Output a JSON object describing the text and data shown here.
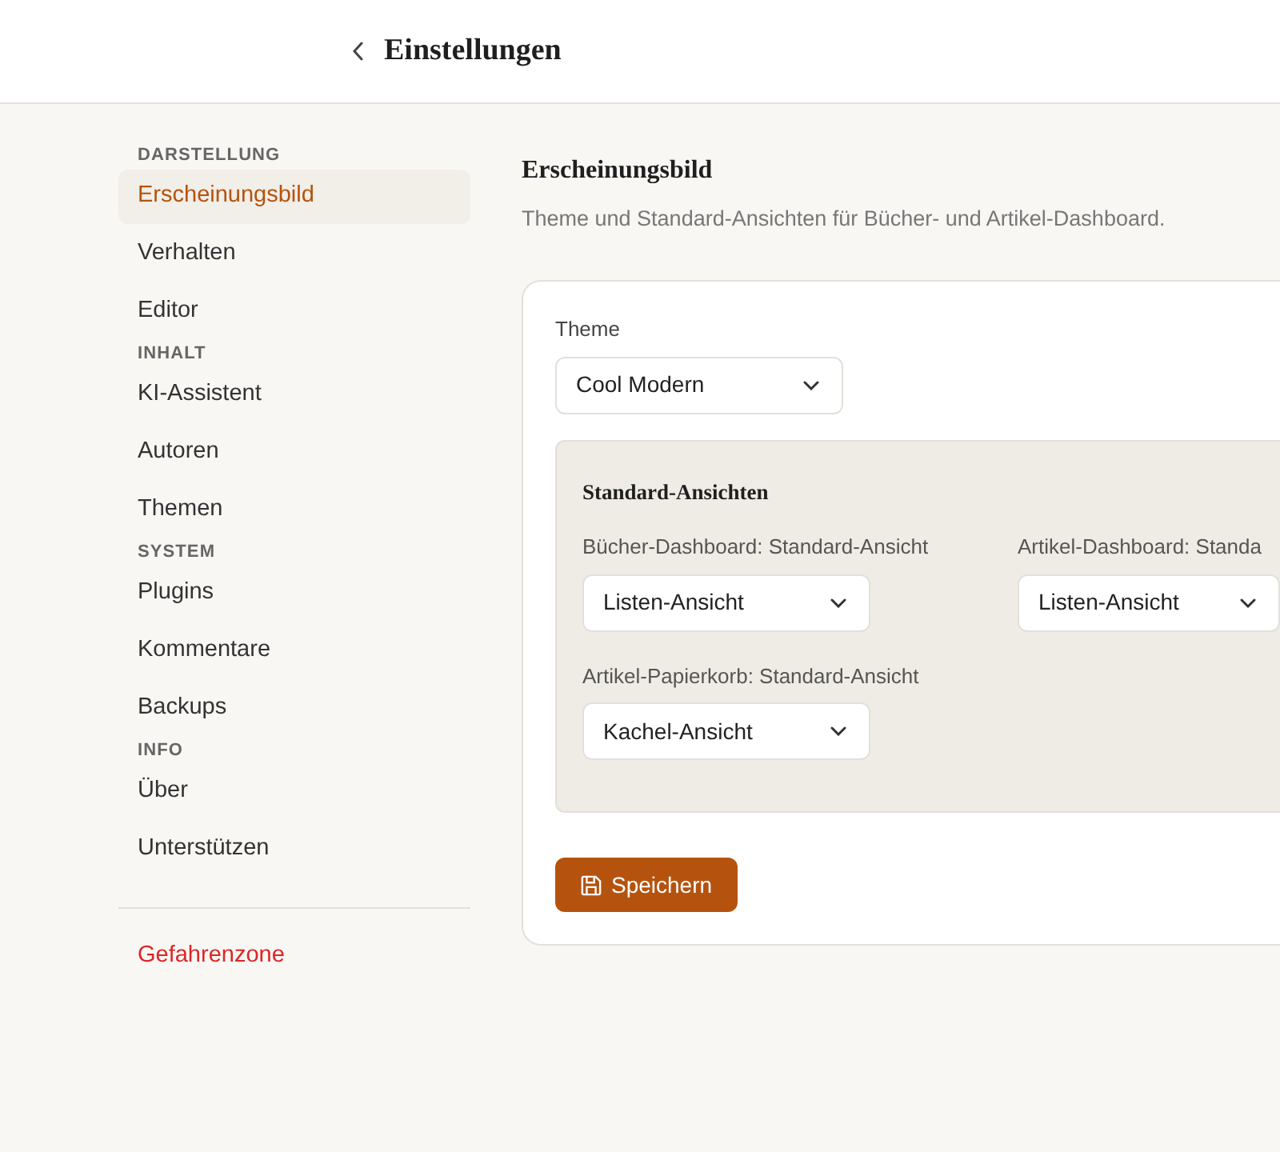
{
  "header": {
    "title": "Einstellungen"
  },
  "sidebar": {
    "sections": [
      {
        "heading": "DARSTELLUNG",
        "items": [
          {
            "label": "Erscheinungsbild",
            "selected": true
          },
          {
            "label": "Verhalten",
            "selected": false
          },
          {
            "label": "Editor",
            "selected": false
          }
        ]
      },
      {
        "heading": "INHALT",
        "items": [
          {
            "label": "KI-Assistent",
            "selected": false
          },
          {
            "label": "Autoren",
            "selected": false
          },
          {
            "label": "Themen",
            "selected": false
          }
        ]
      },
      {
        "heading": "SYSTEM",
        "items": [
          {
            "label": "Plugins",
            "selected": false
          },
          {
            "label": "Kommentare",
            "selected": false
          },
          {
            "label": "Backups",
            "selected": false
          }
        ]
      },
      {
        "heading": "INFO",
        "items": [
          {
            "label": "Über",
            "selected": false
          },
          {
            "label": "Unterstützen",
            "selected": false
          }
        ]
      }
    ],
    "danger_item": {
      "label": "Gefahrenzone"
    }
  },
  "main": {
    "title": "Erscheinungsbild",
    "subtitle": "Theme und Standard-Ansichten für Bücher- und Artikel-Dashboard.",
    "theme": {
      "label": "Theme",
      "value": "Cool Modern"
    },
    "defaults": {
      "heading": "Standard-Ansichten",
      "fields": [
        {
          "label": "Bücher-Dashboard: Standard-Ansicht",
          "value": "Listen-Ansicht"
        },
        {
          "label": "Artikel-Dashboard: Standa",
          "value": "Listen-Ansicht"
        },
        {
          "label": "Artikel-Papierkorb: Standard-Ansicht",
          "value": "Kachel-Ansicht"
        }
      ]
    },
    "save_button": {
      "label": "Speichern"
    }
  }
}
